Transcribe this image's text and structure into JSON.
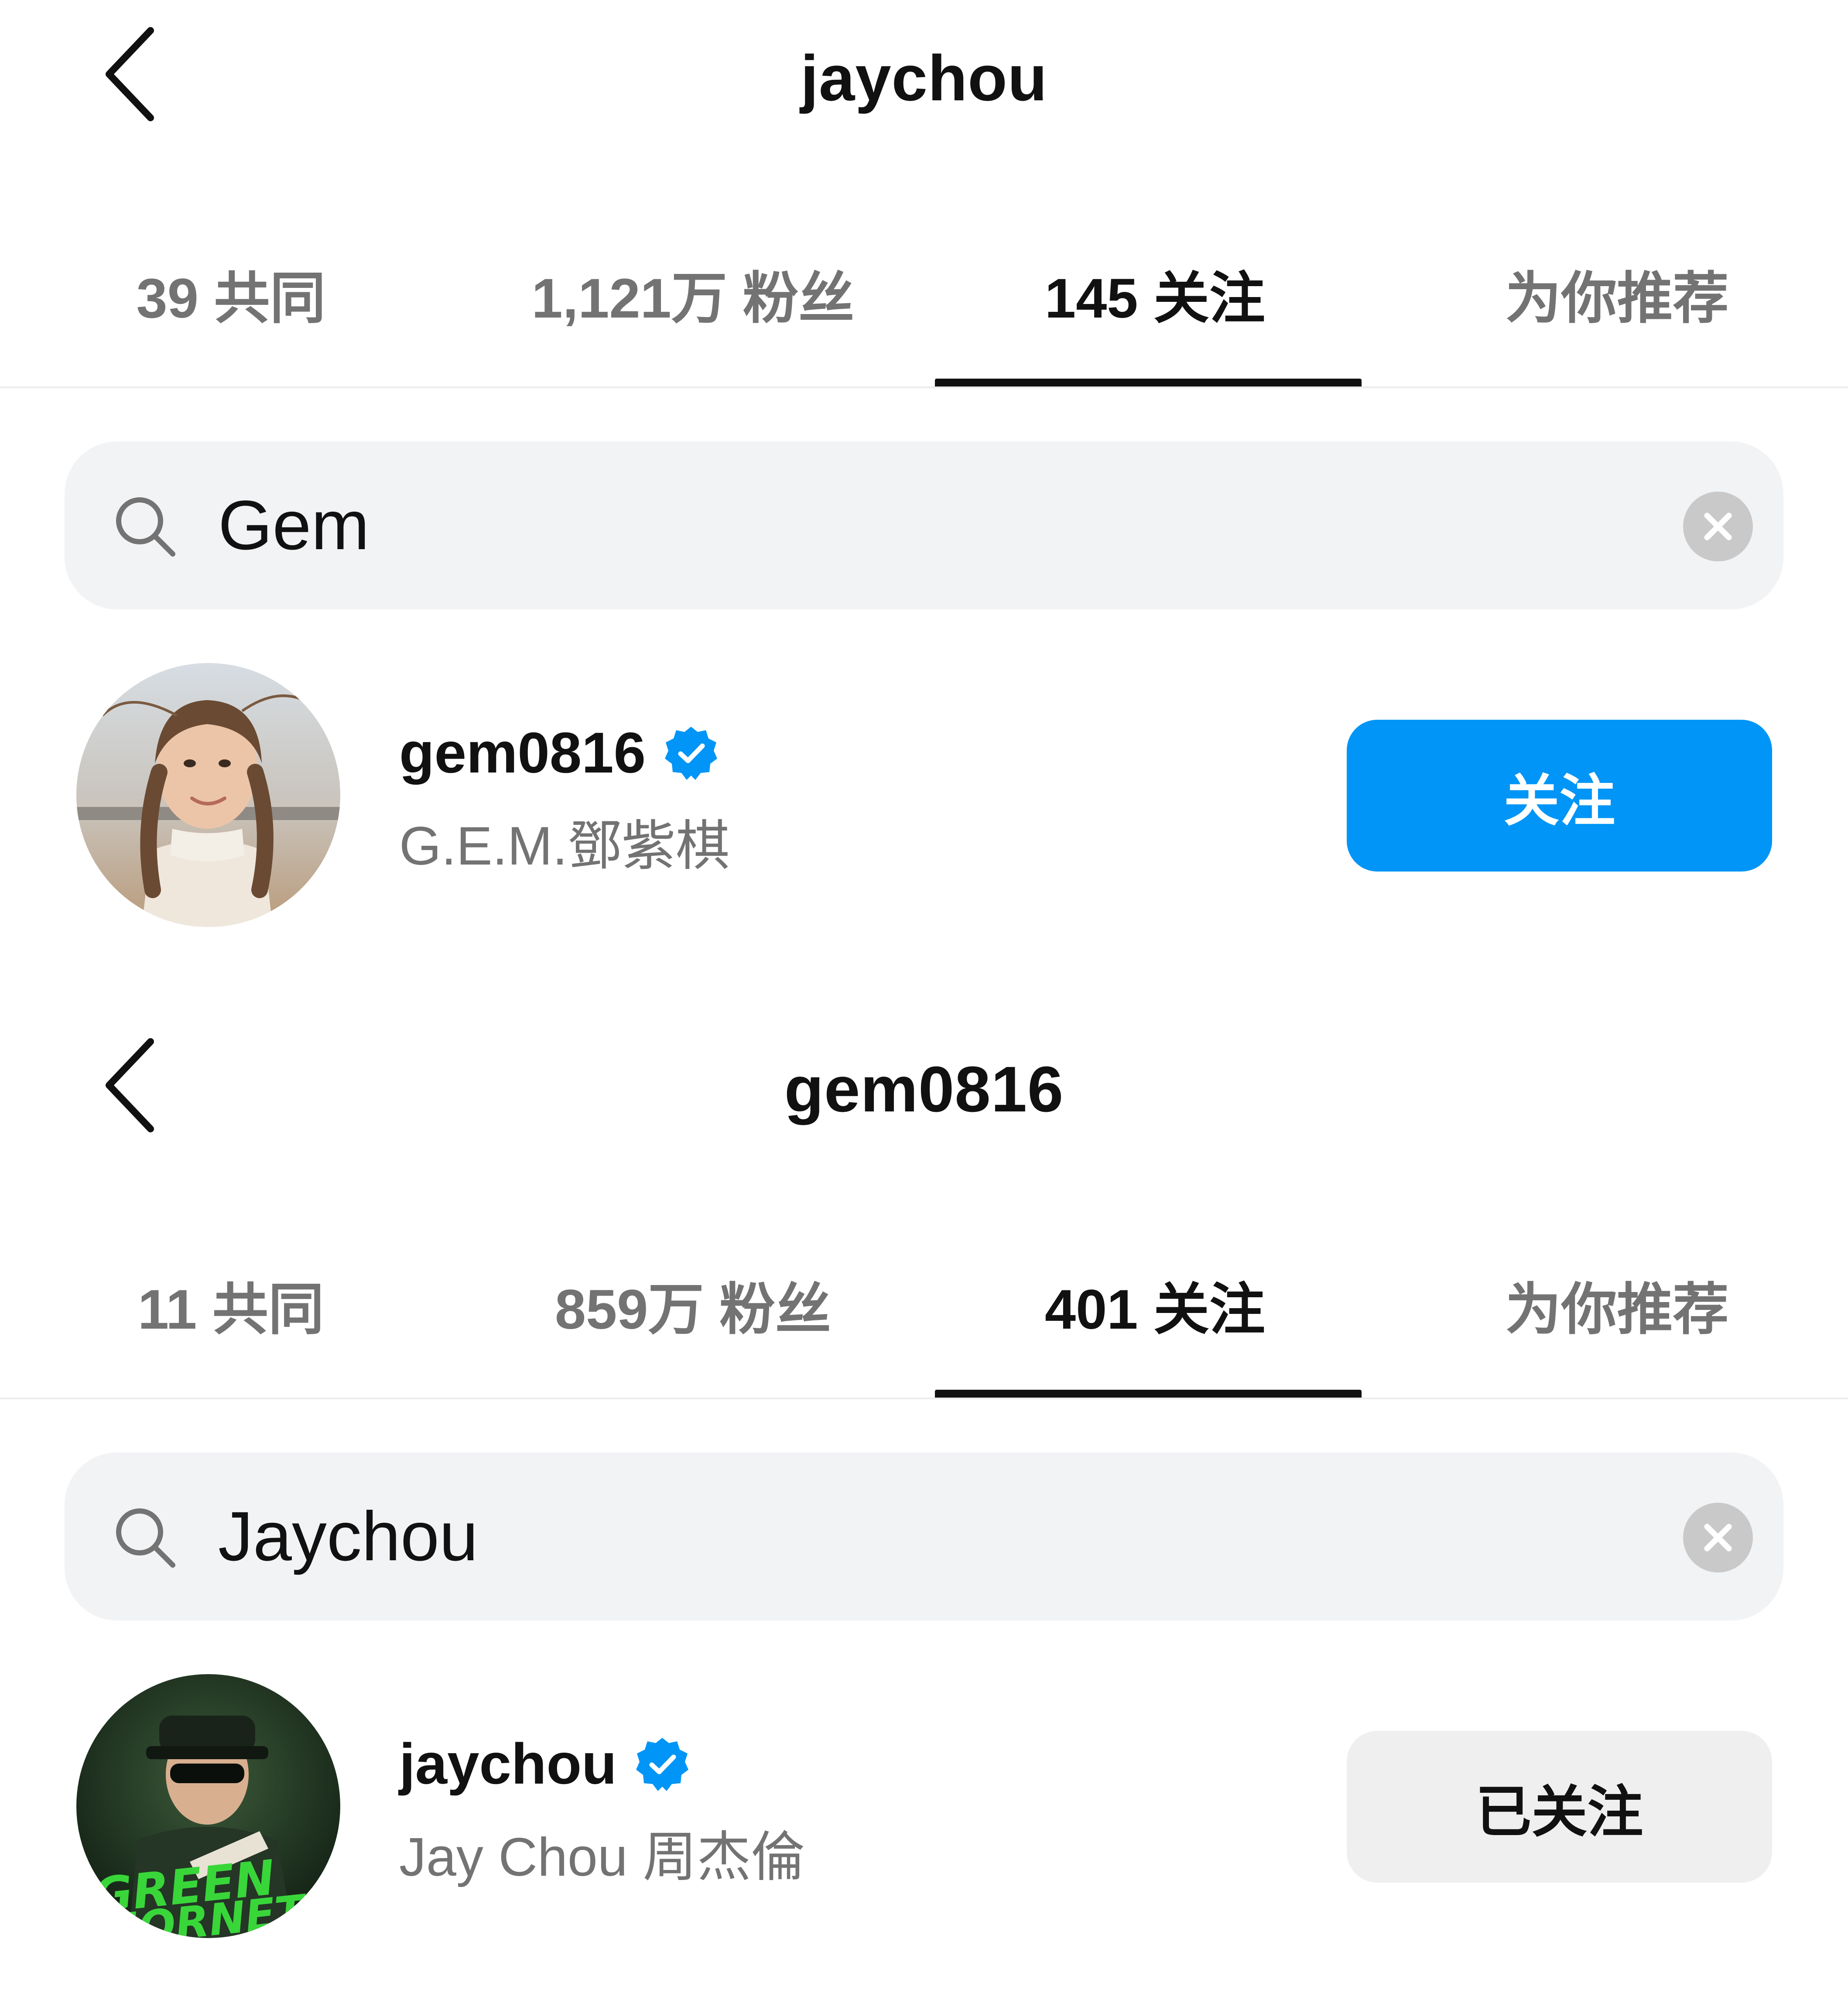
{
  "panels": [
    {
      "title": "jaychou",
      "tabs": [
        "39 共同",
        "1,121万 粉丝",
        "145 关注",
        "为你推荐"
      ],
      "active_tab": 2,
      "search": {
        "value": "Gem"
      },
      "result": {
        "username": "gem0816",
        "fullname": "G.E.M.鄧紫棋",
        "verified": true,
        "button_label": "关注",
        "button_state": "follow"
      }
    },
    {
      "title": "gem0816",
      "tabs": [
        "11 共同",
        "859万 粉丝",
        "401 关注",
        "为你推荐"
      ],
      "active_tab": 2,
      "search": {
        "value": "Jaychou"
      },
      "result": {
        "username": "jaychou",
        "fullname": "Jay Chou 周杰倫",
        "verified": true,
        "button_label": "已关注",
        "button_state": "following"
      }
    }
  ],
  "icons": {
    "back": "chevron-left-icon",
    "search": "search-icon",
    "clear": "clear-icon",
    "verified": "verified-badge-icon"
  },
  "colors": {
    "primary": "#0095f6",
    "verified": "#0095f6",
    "text": "#111111",
    "muted": "#737373",
    "search_bg": "#f2f3f5"
  }
}
